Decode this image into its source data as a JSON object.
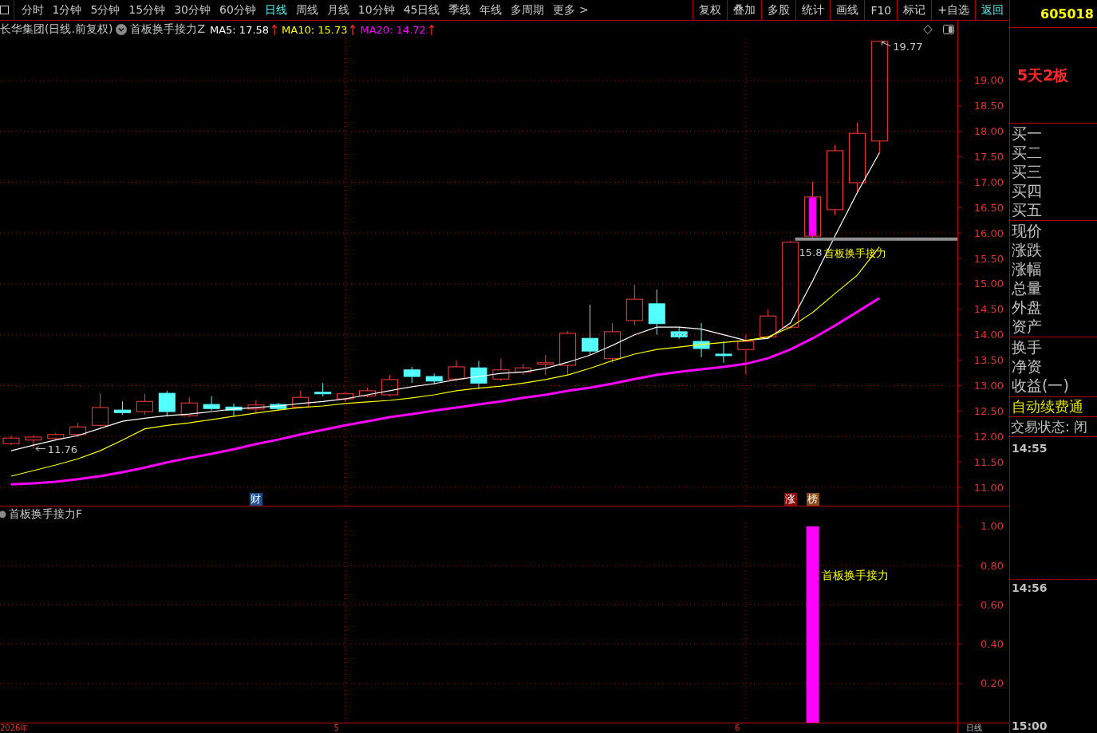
{
  "toolbar": {
    "periods": [
      {
        "label": "分时",
        "selected": false
      },
      {
        "label": "1分钟",
        "selected": false
      },
      {
        "label": "5分钟",
        "selected": false
      },
      {
        "label": "15分钟",
        "selected": false
      },
      {
        "label": "30分钟",
        "selected": false
      },
      {
        "label": "60分钟",
        "selected": false
      },
      {
        "label": "日线",
        "selected": true
      },
      {
        "label": "周线",
        "selected": false
      },
      {
        "label": "月线",
        "selected": false
      },
      {
        "label": "10分钟",
        "selected": false
      },
      {
        "label": "45日线",
        "selected": false
      },
      {
        "label": "季线",
        "selected": false
      },
      {
        "label": "年线",
        "selected": false
      },
      {
        "label": "多周期",
        "selected": false
      },
      {
        "label": "更多 >",
        "selected": false
      }
    ],
    "actions": [
      {
        "label": "复权",
        "kind": "normal"
      },
      {
        "label": "叠加",
        "kind": "normal"
      },
      {
        "label": "多股",
        "kind": "normal"
      },
      {
        "label": "统计",
        "kind": "normal"
      },
      {
        "label": "画线",
        "kind": "normal"
      },
      {
        "label": "F10",
        "kind": "normal"
      },
      {
        "label": "标记",
        "kind": "normal"
      },
      {
        "label": "+自选",
        "kind": "normal"
      },
      {
        "label": "返回",
        "kind": "accent"
      }
    ]
  },
  "main_chart": {
    "title": "长华集团(日线.前复权)",
    "indicator": "首板换手接力Z",
    "ma_readings": [
      {
        "text": "MA5: 17.58",
        "color": "#ffffff",
        "rising": true
      },
      {
        "text": "MA10: 15.73",
        "color": "#ffff00",
        "rising": true
      },
      {
        "text": "MA20: 14.72",
        "color": "#ff00ff",
        "rising": true
      }
    ],
    "chart_data": {
      "type": "line",
      "grid": true,
      "categories": [
        null,
        null,
        null,
        null,
        null,
        null,
        null,
        null,
        null,
        null,
        null,
        null,
        null,
        null,
        null,
        null,
        null,
        null,
        null,
        null,
        null,
        null,
        null,
        null,
        null,
        null,
        null,
        null,
        null,
        null,
        null,
        null,
        null,
        null,
        null,
        null,
        null,
        null,
        null,
        null,
        null,
        null,
        null
      ],
      "ylim": [
        10.64,
        19.83
      ],
      "yticks": [
        {
          "value": 11,
          "label": "11.00"
        },
        {
          "value": 11.5,
          "label": "11.50"
        },
        {
          "value": 12,
          "label": "12.00"
        },
        {
          "value": 12.5,
          "label": "12.50"
        },
        {
          "value": 13,
          "label": "13.00"
        },
        {
          "value": 13.5,
          "label": "13.50"
        },
        {
          "value": 14,
          "label": "14.00"
        },
        {
          "value": 14.5,
          "label": "14.50"
        },
        {
          "value": 15,
          "label": "15.00"
        },
        {
          "value": 15.5,
          "label": "15.50"
        },
        {
          "value": 16,
          "label": "16.00"
        },
        {
          "value": 16.5,
          "label": "16.50"
        },
        {
          "value": 17,
          "label": "17.00"
        },
        {
          "value": 17.5,
          "label": "17.50"
        },
        {
          "value": 18,
          "label": "18.00"
        },
        {
          "value": 18.5,
          "label": "18.50"
        },
        {
          "value": 19,
          "label": "19.00"
        }
      ],
      "series": [
        {
          "color": "#ffffff",
          "values": [
            11.72,
            11.83,
            11.93,
            12.02,
            12.16,
            12.3,
            12.36,
            12.41,
            12.44,
            12.49,
            12.54,
            12.57,
            12.6,
            12.65,
            12.69,
            12.74,
            12.82,
            12.9,
            12.98,
            13.04,
            13.12,
            13.18,
            13.24,
            13.27,
            13.34,
            13.46,
            13.6,
            13.79,
            14.0,
            14.15,
            14.15,
            14.11,
            14.0,
            13.89,
            13.93,
            14.23,
            15.06,
            15.94,
            16.79,
            17.58,
            null,
            null,
            null
          ]
        },
        {
          "color": "#ffff00",
          "values": [
            11.22,
            11.33,
            11.44,
            11.56,
            11.72,
            11.93,
            12.15,
            12.22,
            12.27,
            12.33,
            12.4,
            12.46,
            12.52,
            12.57,
            12.6,
            12.65,
            12.68,
            12.71,
            12.76,
            12.82,
            12.9,
            12.95,
            12.99,
            13.05,
            13.12,
            13.21,
            13.34,
            13.49,
            13.62,
            13.71,
            13.76,
            13.81,
            13.85,
            13.89,
            13.96,
            14.15,
            14.44,
            14.81,
            15.17,
            15.73,
            null,
            null,
            null
          ]
        },
        {
          "color": "#ff00ff",
          "values": [
            11.06,
            11.08,
            11.11,
            11.16,
            11.22,
            11.3,
            11.39,
            11.49,
            11.58,
            11.66,
            11.75,
            11.85,
            11.94,
            12.04,
            12.13,
            12.22,
            12.3,
            12.38,
            12.44,
            12.51,
            12.57,
            12.63,
            12.69,
            12.76,
            12.82,
            12.9,
            12.96,
            13.04,
            13.13,
            13.21,
            13.27,
            13.32,
            13.37,
            13.43,
            13.54,
            13.71,
            13.93,
            14.18,
            14.45,
            14.72,
            null,
            null,
            null
          ]
        }
      ],
      "ref_lines": [
        {
          "axis": "y",
          "value": 15.88
        }
      ],
      "annotations": [
        "11.76",
        "19.77",
        "15.8",
        "首板换手接力"
      ]
    },
    "event_badges": [
      {
        "text": "财",
        "color": "#1d4f8f"
      },
      {
        "text": "涨",
        "color": "#8c0a0a"
      },
      {
        "text": "榜",
        "color": "#8a4812"
      }
    ]
  },
  "indicator_panel": {
    "title": "首板换手接力F",
    "chart_data": {
      "type": "bar",
      "grid": true,
      "categories": [
        "2026年",
        null,
        null,
        null,
        null,
        null,
        null,
        null,
        null,
        null,
        null,
        null,
        null,
        null,
        null,
        "5",
        null,
        null,
        null,
        null,
        null,
        null,
        null,
        null,
        null,
        null,
        null,
        null,
        null,
        null,
        null,
        null,
        null,
        "6",
        null,
        null,
        null,
        null,
        null,
        null,
        null,
        null,
        null
      ],
      "ylim": [
        0,
        1.02
      ],
      "yticks": [
        {
          "value": 0.2,
          "label": "0.20"
        },
        {
          "value": 0.4,
          "label": "0.40"
        },
        {
          "value": 0.6,
          "label": "0.60"
        },
        {
          "value": 0.8,
          "label": "0.80"
        },
        {
          "value": 1,
          "label": "1.00"
        }
      ],
      "series": [
        {
          "color": "#ff00ff",
          "values": [
            0,
            0,
            0,
            0,
            0,
            0,
            0,
            0,
            0,
            0,
            0,
            0,
            0,
            0,
            0,
            0,
            0,
            0,
            0,
            0,
            0,
            0,
            0,
            0,
            0,
            0,
            0,
            0,
            0,
            0,
            0,
            0,
            0,
            0,
            0,
            0,
            1,
            0,
            0,
            0,
            null,
            null,
            null
          ]
        }
      ],
      "annotations": [
        "首板换手接力"
      ]
    }
  },
  "date_axis": {
    "period": "日线"
  },
  "quote_panel": {
    "code": "605018",
    "tag": "5天2板",
    "bid_labels": [
      "买一",
      "买二",
      "买三",
      "买四",
      "买五"
    ],
    "stat_labels": [
      "现价",
      "涨跌",
      "涨幅",
      "总量",
      "外盘",
      "资产"
    ],
    "finance_labels": [
      "换手",
      "净资",
      "收益(一)"
    ],
    "notice": "自动续费通",
    "status": "交易状态: 闭",
    "times": [
      "14:55",
      "14:56",
      "15:00"
    ]
  }
}
